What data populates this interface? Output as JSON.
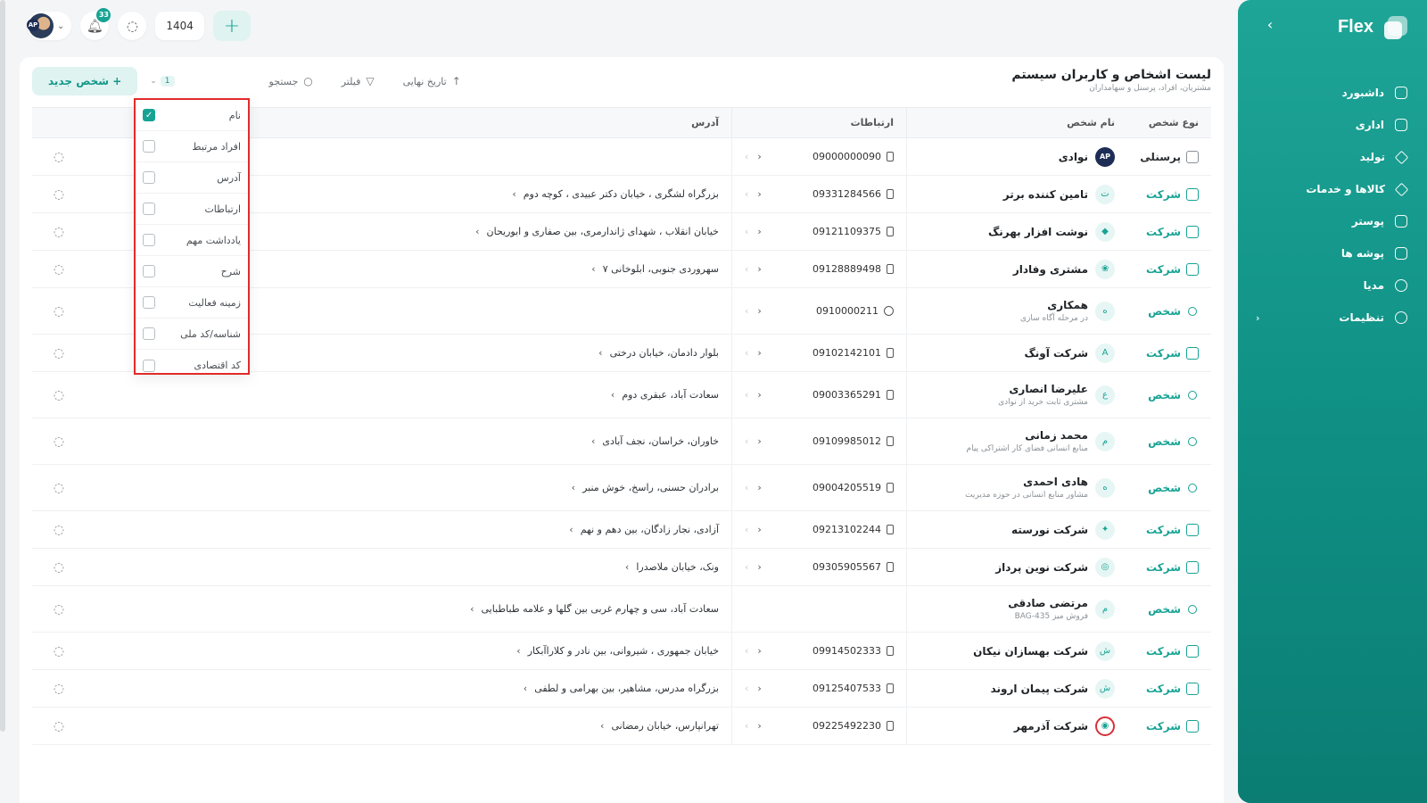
{
  "sidebar": {
    "brand": "Flex",
    "items": [
      {
        "label": "داشبورد",
        "icon": "home-icon"
      },
      {
        "label": "اداری",
        "icon": "briefcase-icon"
      },
      {
        "label": "تولید",
        "icon": "tool-icon"
      },
      {
        "label": "کالاها و خدمات",
        "icon": "box-icon"
      },
      {
        "label": "پوستر",
        "icon": "image-icon"
      },
      {
        "label": "پوشه ها",
        "icon": "folder-icon"
      },
      {
        "label": "مدیا",
        "icon": "globe-icon"
      },
      {
        "label": "تنظیمات",
        "icon": "gear-icon"
      }
    ]
  },
  "topbar": {
    "notifications_count": "33",
    "year": "1404",
    "add_symbol": "+",
    "avatar_initials": "AP"
  },
  "page": {
    "title": "لیست اشخاص و کاربران سیستم",
    "subtitle": "مشتریان، افراد، پرسنل و سهامداران"
  },
  "toolbar": {
    "new_person": "+ شخص جدید",
    "selected_count": "1",
    "search": "جستجو",
    "filter": "فیلتر",
    "sort": "تاریخ نهایی"
  },
  "columns": {
    "type": "نوع شخص",
    "name": "نام شخص",
    "comm": "ارتباطات",
    "address": "آدرس"
  },
  "column_selector": [
    {
      "label": "نام",
      "checked": true
    },
    {
      "label": "افراد مرتبط",
      "checked": false
    },
    {
      "label": "آدرس",
      "checked": false
    },
    {
      "label": "ارتباطات",
      "checked": false
    },
    {
      "label": "یادداشت مهم",
      "checked": false
    },
    {
      "label": "شرح",
      "checked": false
    },
    {
      "label": "زمینه فعالیت",
      "checked": false
    },
    {
      "label": "شناسه/کد ملی",
      "checked": false
    },
    {
      "label": "کد اقتصادی",
      "checked": false
    }
  ],
  "rows": [
    {
      "type": "پرسنلی",
      "name": "نوادی",
      "sub": "",
      "avatar": "AP",
      "phone": "09000000090",
      "phone_kind": "mobile",
      "address": ""
    },
    {
      "type": "شرکت",
      "name": "تامین کننده برتر",
      "sub": "",
      "avatar": "ت",
      "phone": "09331284566",
      "phone_kind": "mobile",
      "address": "بزرگراه لشگری ، خیابان دکتر عبیدی ، کوچه دوم"
    },
    {
      "type": "شرکت",
      "name": "نوشت افزار بهرنگ",
      "sub": "",
      "avatar": "◆",
      "phone": "09121109375",
      "phone_kind": "mobile",
      "address": "خیابان انقلاب ، شهدای ژاندارمری، بین صفاری و ابوریحان"
    },
    {
      "type": "شرکت",
      "name": "مشتری وفادار",
      "sub": "",
      "avatar": "❀",
      "phone": "09128889498",
      "phone_kind": "mobile",
      "address": "سهروردی جنوبی، ابلوخانی ۷"
    },
    {
      "type": "شخص",
      "name": "همکاری",
      "sub": "در مرحله آگاه سازی",
      "avatar": "ه",
      "phone": "0910000211",
      "phone_kind": "whatsapp",
      "address": ""
    },
    {
      "type": "شرکت",
      "name": "شرکت آونگ",
      "sub": "",
      "avatar": "A",
      "phone": "09102142101",
      "phone_kind": "mobile",
      "address": "بلوار دادمان، خیابان درختی"
    },
    {
      "type": "شخص",
      "name": "علیرضا انصاری",
      "sub": "مشتری ثابت خرید از نوادی",
      "avatar": "ع",
      "phone": "09003365291",
      "phone_kind": "mobile",
      "address": "سعادت آباد، عبقری دوم"
    },
    {
      "type": "شخص",
      "name": "محمد زمانی",
      "sub": "منابع انسانی فضای کار اشتراکی پیام",
      "avatar": "م",
      "phone": "09109985012",
      "phone_kind": "mobile",
      "address": "خاوران، خراسان، نجف آبادی"
    },
    {
      "type": "شخص",
      "name": "هادی احمدی",
      "sub": "مشاور منابع انسانی در حوزه مدیریت",
      "avatar": "ه",
      "phone": "09004205519",
      "phone_kind": "mobile",
      "address": "برادران حسنی، راسخ، خوش منبر"
    },
    {
      "type": "شرکت",
      "name": "شرکت نورسته",
      "sub": "",
      "avatar": "✦",
      "phone": "09213102244",
      "phone_kind": "mobile",
      "address": "آزادی، نجار زادگان، بین دهم و نهم"
    },
    {
      "type": "شرکت",
      "name": "شرکت نوین پرداز",
      "sub": "",
      "avatar": "◎",
      "phone": "09305905567",
      "phone_kind": "mobile",
      "address": "ونک، خیابان ملاصدرا"
    },
    {
      "type": "شخص",
      "name": "مرتضی صادقی",
      "sub": "فروش میز BAG-435",
      "avatar": "م",
      "phone": "",
      "phone_kind": "none",
      "address": "سعادت آباد، سی و چهارم غربی بین گلها و علامه طباطبایی"
    },
    {
      "type": "شرکت",
      "name": "شرکت بهسازان نیکان",
      "sub": "",
      "avatar": "ش",
      "phone": "09914502333",
      "phone_kind": "mobile",
      "address": "خیابان جمهوری ، شیروانی، بین نادر و کلاراآبکار"
    },
    {
      "type": "شرکت",
      "name": "شرکت پیمان اروند",
      "sub": "",
      "avatar": "ش",
      "phone": "09125407533",
      "phone_kind": "mobile",
      "address": "بزرگراه مدرس، مشاهیر، بین بهرامی و لطفی"
    },
    {
      "type": "شرکت",
      "name": "شرکت آذرمهر",
      "sub": "",
      "avatar": "◉",
      "phone": "09225492230",
      "phone_kind": "mobile",
      "address": "تهرانپارس، خیابان رمضانی"
    }
  ],
  "colors": {
    "accent": "#16a394",
    "sidebar": "#0f8f84",
    "highlight": "#e32a2a"
  }
}
